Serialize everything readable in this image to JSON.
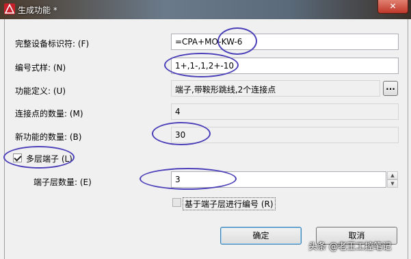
{
  "window": {
    "title": "生成功能 *"
  },
  "fields": {
    "device_id_label": "完整设备标识符: (F)",
    "device_id_value": "=CPA+MO-KW-6",
    "numbering_label": "编号式样: (N)",
    "numbering_value": "1+,1-,1,2+-10",
    "function_def_label": "功能定义: (U)",
    "function_def_value": "端子,带鞍形跳线,2个连接点",
    "browse_label": "...",
    "connection_count_label": "连接点的数量: (M)",
    "connection_count_value": "4",
    "new_function_count_label": "新功能的数量: (B)",
    "new_function_count_value": "30",
    "multilevel_label": "多层端子 (L)",
    "multilevel_checked": true,
    "levels_label": "端子层数量: (E)",
    "levels_value": "3",
    "number_by_level_label": "基于端子层进行编号 (R)",
    "number_by_level_checked": false
  },
  "buttons": {
    "ok": "确定",
    "cancel": "取消"
  },
  "watermark": "头条 @老王工控笔记",
  "colors": {
    "annotation": "#4a3fb8",
    "close": "#c0382a"
  }
}
